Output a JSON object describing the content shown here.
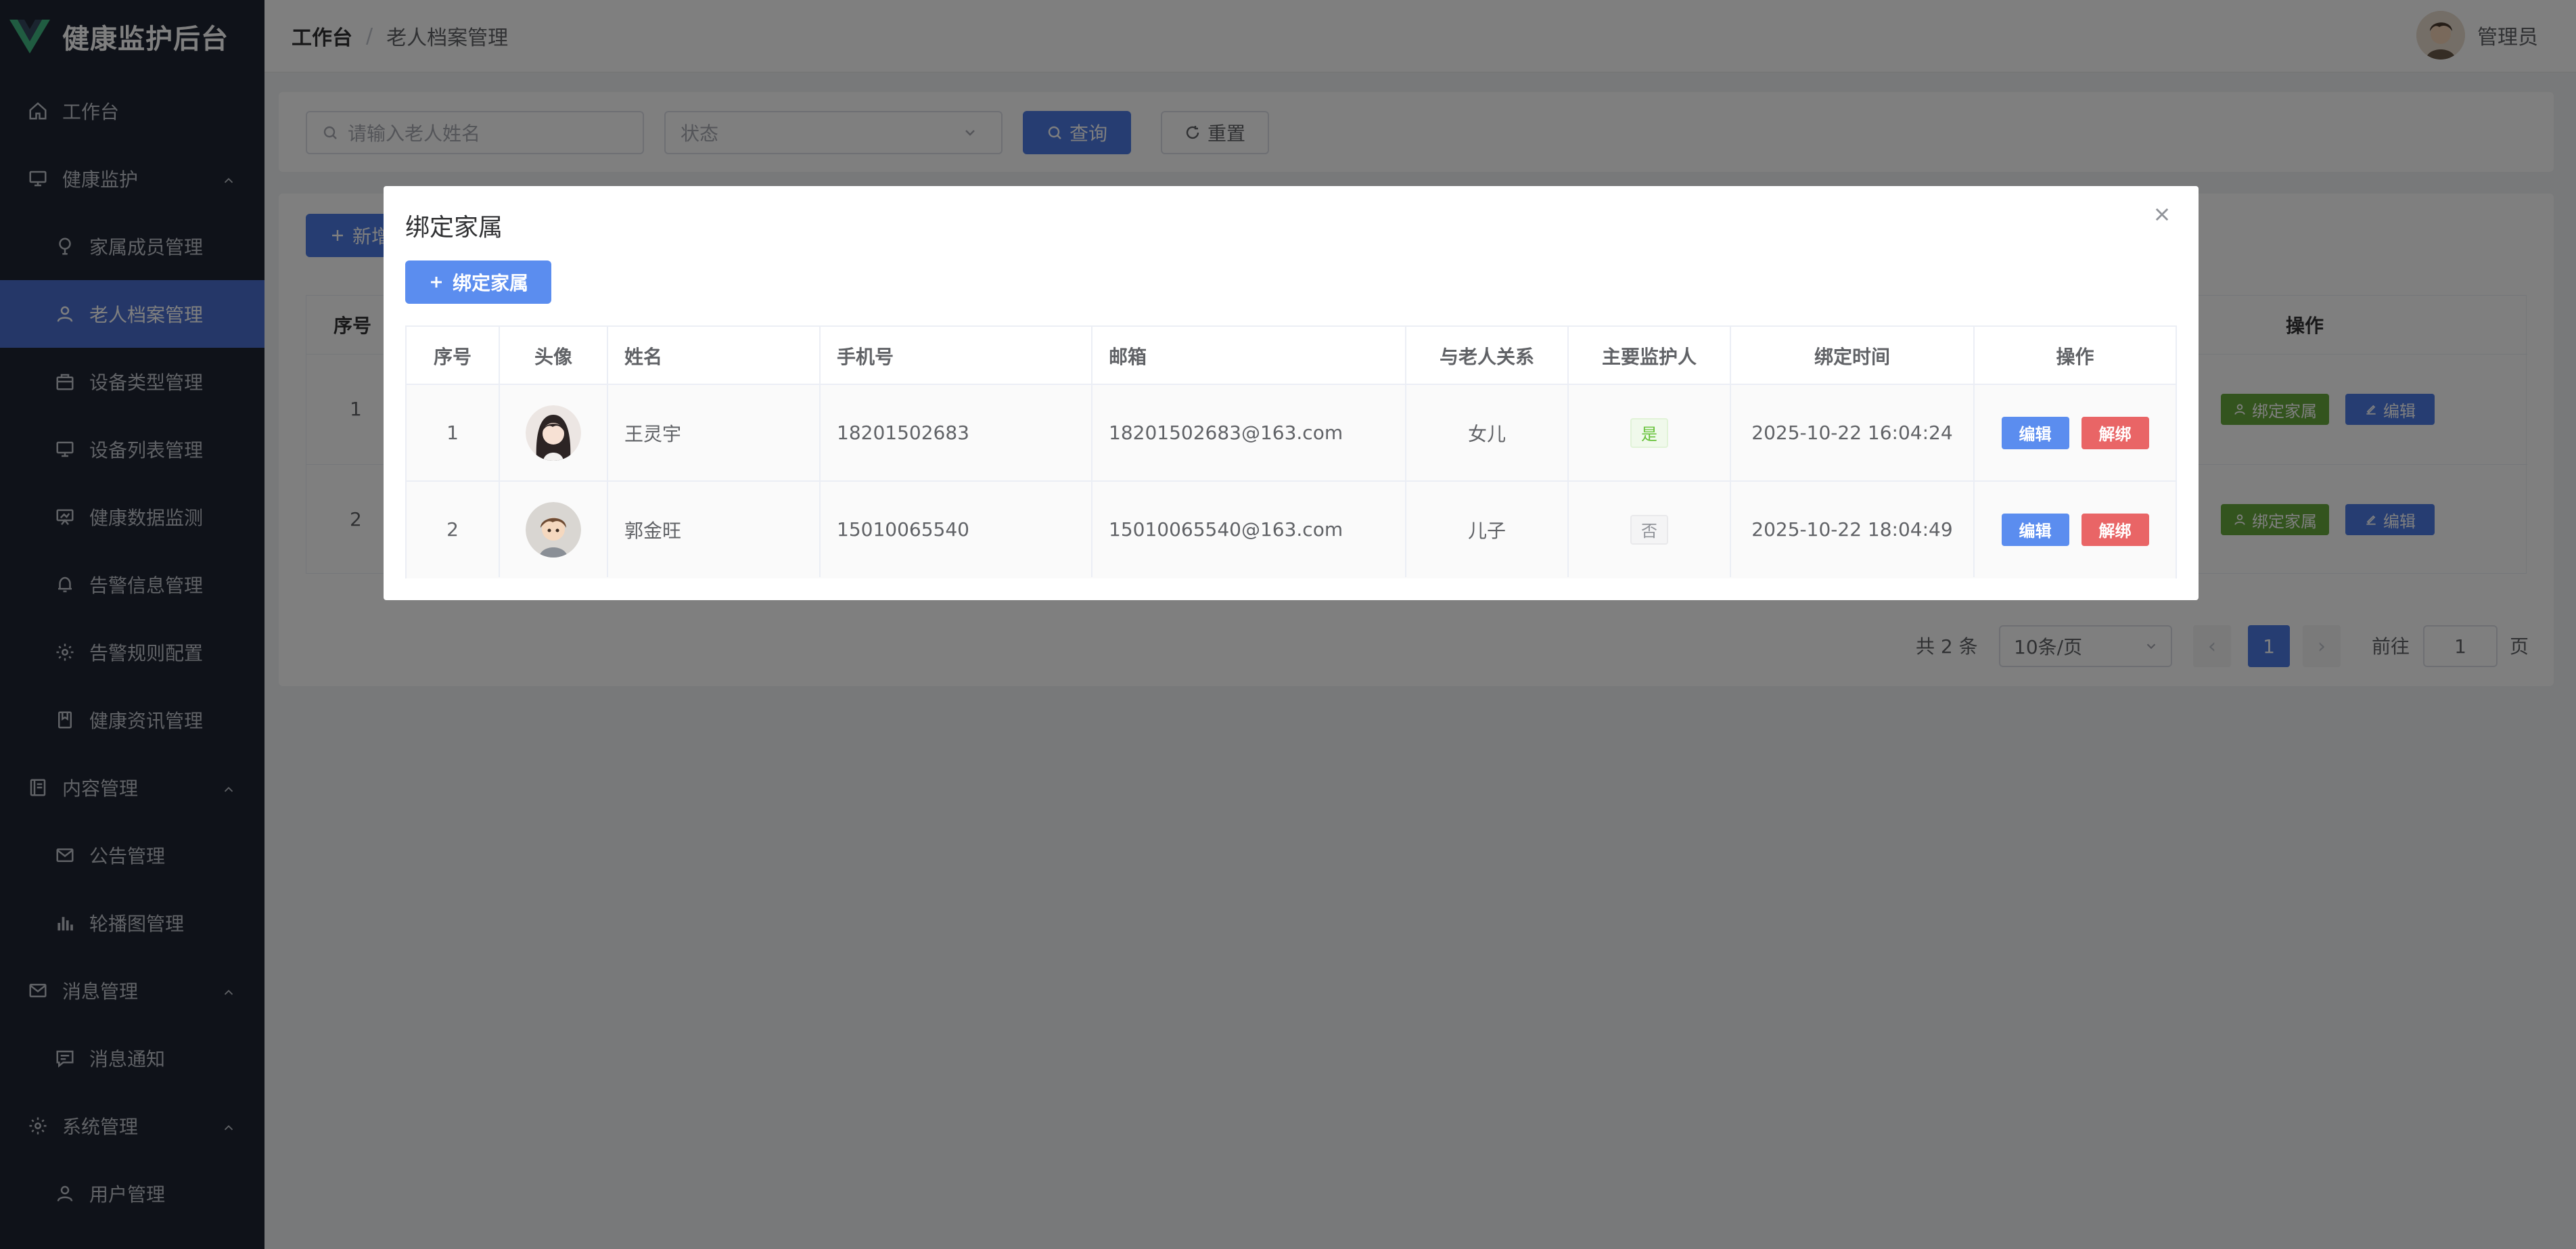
{
  "app": {
    "title": "健康监护后台",
    "brand_color": "#41b883"
  },
  "sidebar": {
    "items": [
      {
        "label": "工作台",
        "icon": "home-icon",
        "level": "top"
      },
      {
        "label": "健康监护",
        "icon": "monitor-icon",
        "level": "top",
        "expanded": true
      },
      {
        "label": "家属成员管理",
        "icon": "location-icon",
        "level": "sub"
      },
      {
        "label": "老人档案管理",
        "icon": "user-icon",
        "level": "sub",
        "active": true
      },
      {
        "label": "设备类型管理",
        "icon": "briefcase-icon",
        "level": "sub"
      },
      {
        "label": "设备列表管理",
        "icon": "monitor-icon",
        "level": "sub"
      },
      {
        "label": "健康数据监测",
        "icon": "data-board-icon",
        "level": "sub"
      },
      {
        "label": "告警信息管理",
        "icon": "bell-icon",
        "level": "sub"
      },
      {
        "label": "告警规则配置",
        "icon": "gear-icon",
        "level": "sub"
      },
      {
        "label": "健康资讯管理",
        "icon": "collection-icon",
        "level": "sub"
      },
      {
        "label": "内容管理",
        "icon": "notebook-icon",
        "level": "top",
        "expanded": true
      },
      {
        "label": "公告管理",
        "icon": "message-icon",
        "level": "sub"
      },
      {
        "label": "轮播图管理",
        "icon": "histogram-icon",
        "level": "sub"
      },
      {
        "label": "消息管理",
        "icon": "message-icon",
        "level": "top",
        "expanded": true
      },
      {
        "label": "消息通知",
        "icon": "chat-icon",
        "level": "sub"
      },
      {
        "label": "系统管理",
        "icon": "gear-icon",
        "level": "top",
        "expanded": true
      },
      {
        "label": "用户管理",
        "icon": "user-icon",
        "level": "sub"
      }
    ]
  },
  "header": {
    "breadcrumb_root": "工作台",
    "breadcrumb_separator": "/",
    "breadcrumb_current": "老人档案管理",
    "user_name": "管理员"
  },
  "search": {
    "name_placeholder": "请输入老人姓名",
    "status_placeholder": "状态",
    "query_label": "查询",
    "reset_label": "重置"
  },
  "background_table": {
    "add_label": "新增",
    "col_index": "序号",
    "col_action": "操作",
    "rows": [
      {
        "index": "1",
        "bind_label": "绑定家属",
        "edit_label": "编辑"
      },
      {
        "index": "2",
        "bind_label": "绑定家属",
        "edit_label": "编辑"
      }
    ]
  },
  "pagination": {
    "total": "共 2 条",
    "page_size": "10条/页",
    "current_page": "1",
    "goto_label": "前往",
    "goto_value": "1",
    "page_suffix": "页"
  },
  "dialog": {
    "title": "绑定家属",
    "bind_button": "绑定家属",
    "columns": [
      "序号",
      "头像",
      "姓名",
      "手机号",
      "邮箱",
      "与老人关系",
      "主要监护人",
      "绑定时间",
      "操作"
    ],
    "rows": [
      {
        "index": "1",
        "avatar": "female-avatar",
        "name": "王灵宇",
        "phone": "18201502683",
        "email": "18201502683@163.com",
        "relation": "女儿",
        "primary": "是",
        "bind_time": "2025-10-22 16:04:24",
        "edit": "编辑",
        "unbind": "解绑"
      },
      {
        "index": "2",
        "avatar": "male-avatar",
        "name": "郭金旺",
        "phone": "15010065540",
        "email": "15010065540@163.com",
        "relation": "儿子",
        "primary": "否",
        "bind_time": "2025-10-22 18:04:49",
        "edit": "编辑",
        "unbind": "解绑"
      }
    ]
  },
  "colors": {
    "sidebar_bg": "#1f2532",
    "active_menu": "#4a6fd1",
    "primary": "#5b8def",
    "danger": "#e96566",
    "success": "#67c23a"
  }
}
